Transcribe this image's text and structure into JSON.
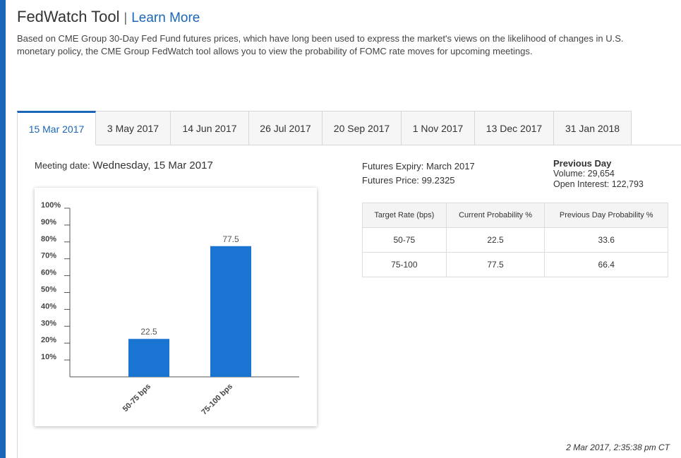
{
  "header": {
    "title": "FedWatch Tool",
    "separator": "|",
    "learn_more": "Learn More"
  },
  "description": {
    "line1": "Based on CME Group 30-Day Fed Fund futures prices, which have long been used to express the market's views on the likelihood of changes in U.S.",
    "line2": "monetary policy, the CME Group FedWatch tool allows you to view the probability of FOMC rate moves for upcoming meetings."
  },
  "tabs": [
    {
      "label": "15 Mar 2017",
      "active": true
    },
    {
      "label": "3 May 2017",
      "active": false
    },
    {
      "label": "14 Jun 2017",
      "active": false
    },
    {
      "label": "26 Jul 2017",
      "active": false
    },
    {
      "label": "20 Sep 2017",
      "active": false
    },
    {
      "label": "1 Nov 2017",
      "active": false
    },
    {
      "label": "13 Dec 2017",
      "active": false
    },
    {
      "label": "31 Jan 2018",
      "active": false
    }
  ],
  "meeting": {
    "label": "Meeting date:",
    "value": "Wednesday, 15 Mar 2017"
  },
  "futures": {
    "expiry_label": "Futures Expiry:",
    "expiry_value": "March 2017",
    "price_label": "Futures Price:",
    "price_value": "99.2325"
  },
  "previous_day": {
    "heading": "Previous Day",
    "volume_label": "Volume:",
    "volume_value": "29,654",
    "oi_label": "Open Interest:",
    "oi_value": "122,793"
  },
  "table": {
    "headers": [
      "Target Rate (bps)",
      "Current Probability %",
      "Previous Day Probability %"
    ],
    "rows": [
      [
        "50-75",
        "22.5",
        "33.6"
      ],
      [
        "75-100",
        "77.5",
        "66.4"
      ]
    ]
  },
  "timestamp": "2 Mar 2017, 2:35:38 pm CT",
  "colors": {
    "accent": "#1a66b8",
    "bar": "#1a75d2"
  },
  "chart_data": {
    "type": "bar",
    "categories": [
      "50-75 bps",
      "75-100 bps"
    ],
    "values": [
      22.5,
      77.5
    ],
    "yticks": [
      "10%",
      "20%",
      "30%",
      "40%",
      "50%",
      "60%",
      "70%",
      "80%",
      "90%",
      "100%"
    ],
    "ylim": [
      0,
      100
    ],
    "title": "",
    "xlabel": "",
    "ylabel": "",
    "grid": false,
    "data_labels": [
      "22.5",
      "77.5"
    ]
  }
}
